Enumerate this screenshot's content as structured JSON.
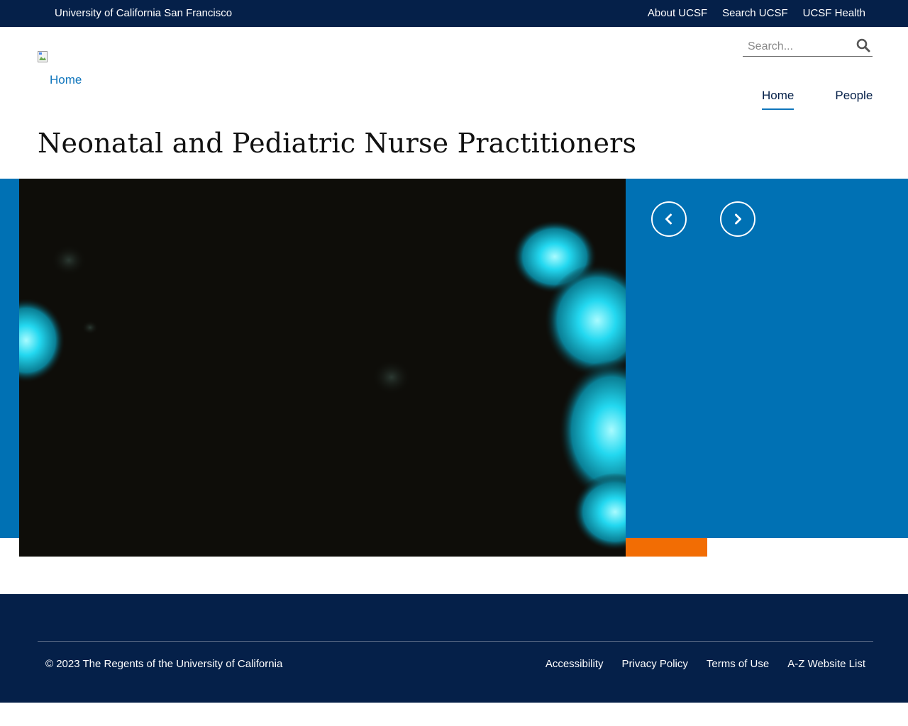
{
  "topbar": {
    "brand": "University of California San Francisco",
    "links": [
      "About UCSF",
      "Search UCSF",
      "UCSF Health"
    ]
  },
  "header": {
    "logo_alt_text": "Home",
    "search": {
      "placeholder": "Search..."
    },
    "nav": [
      {
        "label": "Home",
        "active": true
      },
      {
        "label": "People",
        "active": false
      }
    ]
  },
  "page": {
    "title": "Neonatal and Pediatric Nurse Practitioners"
  },
  "hero": {
    "prev_icon": "chevron-left-icon",
    "next_icon": "chevron-right-icon"
  },
  "footer": {
    "copyright": "© 2023 The Regents of the University of California",
    "links": [
      "Accessibility",
      "Privacy Policy",
      "Terms of Use",
      "A-Z Website List"
    ]
  },
  "colors": {
    "navy": "#052049",
    "blue": "#0071b4",
    "link_blue": "#0f75bc",
    "orange": "#f26d04"
  }
}
